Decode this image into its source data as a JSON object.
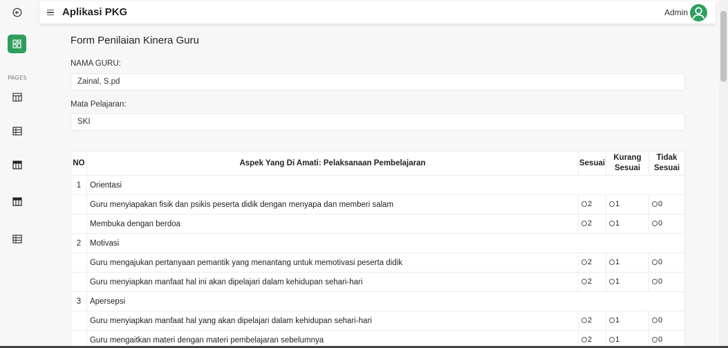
{
  "app": {
    "title": "Aplikasi PKG"
  },
  "header": {
    "user_label": "Admin"
  },
  "sidebar": {
    "section_label": "PAGES",
    "icons": [
      "back-arrow-icon",
      "dashboard-icon",
      "table-icon",
      "list-table-icon",
      "grid-table-icon",
      "grid-table-icon",
      "list-table-icon"
    ]
  },
  "form": {
    "title": "Form Penilaian Kinera Guru",
    "guru_label": "NAMA GURU:",
    "guru_value": "Zainal, S.pd",
    "mapel_label": "Mata Pelajaran:",
    "mapel_value": "SKI"
  },
  "table": {
    "headers": {
      "no": "NO",
      "aspek": "Aspek Yang Di Amati: Pelaksanaan Pembelajaran",
      "sesuai": "Sesuai",
      "kurang_1": "Kurang",
      "kurang_2": "Sesuai",
      "tidak_1": "Tidak",
      "tidak_2": "Sesuai"
    },
    "option_values": {
      "sesuai": "2",
      "kurang": "1",
      "tidak": "0"
    },
    "categories": [
      {
        "no": "1",
        "title": "Orientasi",
        "items": [
          "Guru menyiapakan fisik dan psikis peserta didik dengan menyapa dan memberi salam",
          "Membuka dengan berdoa"
        ]
      },
      {
        "no": "2",
        "title": "Motivasi",
        "items": [
          "Guru mengajukan pertanyaan pemantik yang menantang untuk memotivasi peserta didik",
          "Guru menyiapkan manfaat hal ini akan dipelajari dalam kehidupan sehari-hari"
        ]
      },
      {
        "no": "3",
        "title": "Apersepsi",
        "items": [
          "Guru menyiapkan manfaat hal yang akan dipelajari dalam kehidupan sehari-hari",
          "Guru mengaitkan materi dengan materi pembelajaran sebelumnya"
        ]
      }
    ]
  },
  "colors": {
    "accent": "#2e9e5e",
    "background": "#f7f7f8"
  }
}
